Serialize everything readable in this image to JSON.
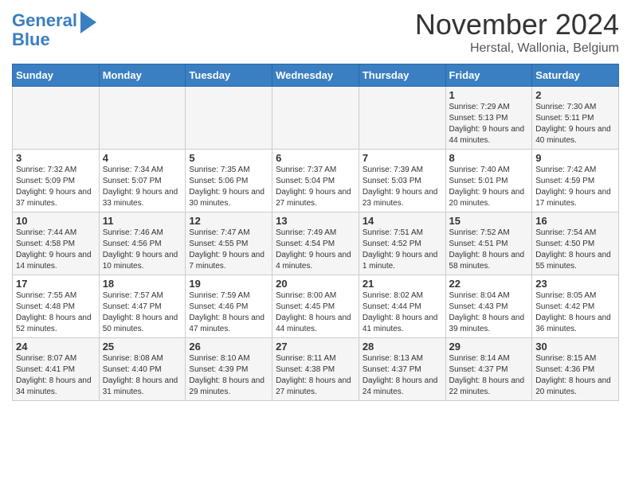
{
  "header": {
    "logo_line1": "General",
    "logo_line2": "Blue",
    "title": "November 2024",
    "location": "Herstal, Wallonia, Belgium"
  },
  "days_of_week": [
    "Sunday",
    "Monday",
    "Tuesday",
    "Wednesday",
    "Thursday",
    "Friday",
    "Saturday"
  ],
  "weeks": [
    [
      {
        "day": "",
        "info": ""
      },
      {
        "day": "",
        "info": ""
      },
      {
        "day": "",
        "info": ""
      },
      {
        "day": "",
        "info": ""
      },
      {
        "day": "",
        "info": ""
      },
      {
        "day": "1",
        "info": "Sunrise: 7:29 AM\nSunset: 5:13 PM\nDaylight: 9 hours and 44 minutes."
      },
      {
        "day": "2",
        "info": "Sunrise: 7:30 AM\nSunset: 5:11 PM\nDaylight: 9 hours and 40 minutes."
      }
    ],
    [
      {
        "day": "3",
        "info": "Sunrise: 7:32 AM\nSunset: 5:09 PM\nDaylight: 9 hours and 37 minutes."
      },
      {
        "day": "4",
        "info": "Sunrise: 7:34 AM\nSunset: 5:07 PM\nDaylight: 9 hours and 33 minutes."
      },
      {
        "day": "5",
        "info": "Sunrise: 7:35 AM\nSunset: 5:06 PM\nDaylight: 9 hours and 30 minutes."
      },
      {
        "day": "6",
        "info": "Sunrise: 7:37 AM\nSunset: 5:04 PM\nDaylight: 9 hours and 27 minutes."
      },
      {
        "day": "7",
        "info": "Sunrise: 7:39 AM\nSunset: 5:03 PM\nDaylight: 9 hours and 23 minutes."
      },
      {
        "day": "8",
        "info": "Sunrise: 7:40 AM\nSunset: 5:01 PM\nDaylight: 9 hours and 20 minutes."
      },
      {
        "day": "9",
        "info": "Sunrise: 7:42 AM\nSunset: 4:59 PM\nDaylight: 9 hours and 17 minutes."
      }
    ],
    [
      {
        "day": "10",
        "info": "Sunrise: 7:44 AM\nSunset: 4:58 PM\nDaylight: 9 hours and 14 minutes."
      },
      {
        "day": "11",
        "info": "Sunrise: 7:46 AM\nSunset: 4:56 PM\nDaylight: 9 hours and 10 minutes."
      },
      {
        "day": "12",
        "info": "Sunrise: 7:47 AM\nSunset: 4:55 PM\nDaylight: 9 hours and 7 minutes."
      },
      {
        "day": "13",
        "info": "Sunrise: 7:49 AM\nSunset: 4:54 PM\nDaylight: 9 hours and 4 minutes."
      },
      {
        "day": "14",
        "info": "Sunrise: 7:51 AM\nSunset: 4:52 PM\nDaylight: 9 hours and 1 minute."
      },
      {
        "day": "15",
        "info": "Sunrise: 7:52 AM\nSunset: 4:51 PM\nDaylight: 8 hours and 58 minutes."
      },
      {
        "day": "16",
        "info": "Sunrise: 7:54 AM\nSunset: 4:50 PM\nDaylight: 8 hours and 55 minutes."
      }
    ],
    [
      {
        "day": "17",
        "info": "Sunrise: 7:55 AM\nSunset: 4:48 PM\nDaylight: 8 hours and 52 minutes."
      },
      {
        "day": "18",
        "info": "Sunrise: 7:57 AM\nSunset: 4:47 PM\nDaylight: 8 hours and 50 minutes."
      },
      {
        "day": "19",
        "info": "Sunrise: 7:59 AM\nSunset: 4:46 PM\nDaylight: 8 hours and 47 minutes."
      },
      {
        "day": "20",
        "info": "Sunrise: 8:00 AM\nSunset: 4:45 PM\nDaylight: 8 hours and 44 minutes."
      },
      {
        "day": "21",
        "info": "Sunrise: 8:02 AM\nSunset: 4:44 PM\nDaylight: 8 hours and 41 minutes."
      },
      {
        "day": "22",
        "info": "Sunrise: 8:04 AM\nSunset: 4:43 PM\nDaylight: 8 hours and 39 minutes."
      },
      {
        "day": "23",
        "info": "Sunrise: 8:05 AM\nSunset: 4:42 PM\nDaylight: 8 hours and 36 minutes."
      }
    ],
    [
      {
        "day": "24",
        "info": "Sunrise: 8:07 AM\nSunset: 4:41 PM\nDaylight: 8 hours and 34 minutes."
      },
      {
        "day": "25",
        "info": "Sunrise: 8:08 AM\nSunset: 4:40 PM\nDaylight: 8 hours and 31 minutes."
      },
      {
        "day": "26",
        "info": "Sunrise: 8:10 AM\nSunset: 4:39 PM\nDaylight: 8 hours and 29 minutes."
      },
      {
        "day": "27",
        "info": "Sunrise: 8:11 AM\nSunset: 4:38 PM\nDaylight: 8 hours and 27 minutes."
      },
      {
        "day": "28",
        "info": "Sunrise: 8:13 AM\nSunset: 4:37 PM\nDaylight: 8 hours and 24 minutes."
      },
      {
        "day": "29",
        "info": "Sunrise: 8:14 AM\nSunset: 4:37 PM\nDaylight: 8 hours and 22 minutes."
      },
      {
        "day": "30",
        "info": "Sunrise: 8:15 AM\nSunset: 4:36 PM\nDaylight: 8 hours and 20 minutes."
      }
    ]
  ]
}
